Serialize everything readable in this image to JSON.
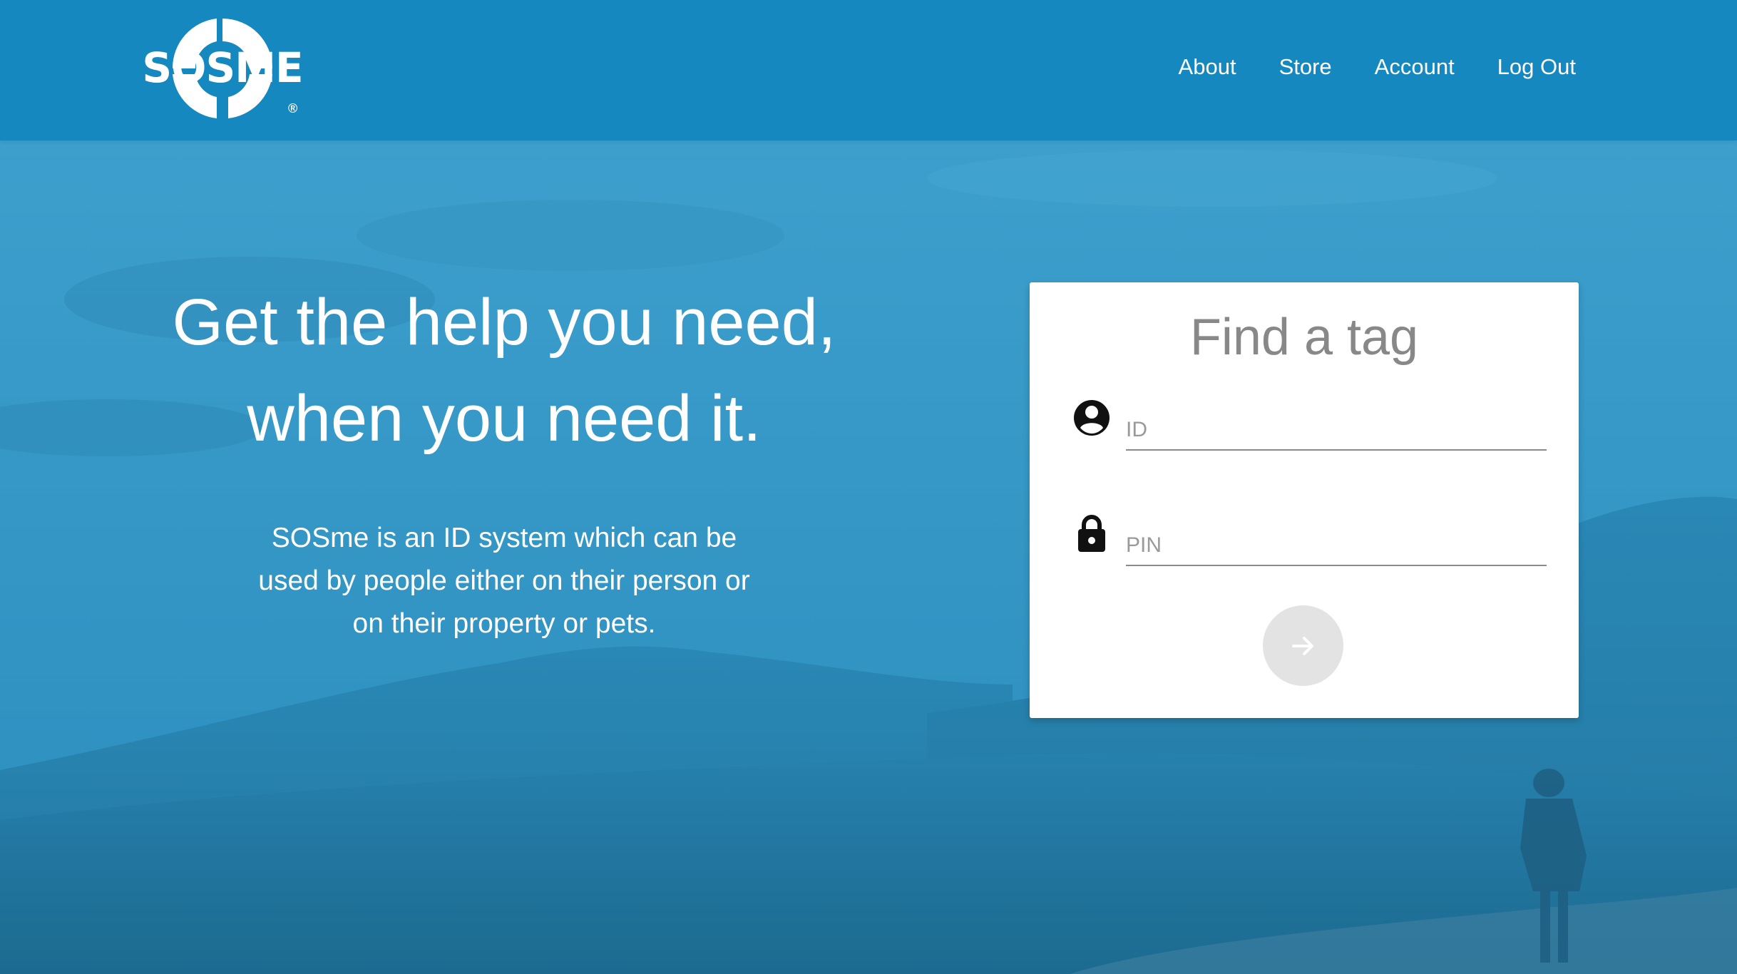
{
  "header": {
    "logo_text": "SOSME",
    "logo_mark": "®",
    "nav": [
      {
        "label": "About"
      },
      {
        "label": "Store"
      },
      {
        "label": "Account"
      },
      {
        "label": "Log Out"
      }
    ]
  },
  "hero": {
    "title_line1": "Get the help you need,",
    "title_line2": "when you need it.",
    "description": "SOSme is an ID system which can be used by people either on their person or on their property or pets."
  },
  "find_tag": {
    "title": "Find a tag",
    "id_field": {
      "placeholder": "ID",
      "value": "",
      "icon": "account-circle-icon"
    },
    "pin_field": {
      "placeholder": "PIN",
      "value": "",
      "icon": "lock-icon"
    },
    "submit_icon": "arrow-right-icon"
  },
  "colors": {
    "header_bg": "#1688c0",
    "card_bg": "#ffffff",
    "submit_bg": "#e3e3e3"
  }
}
